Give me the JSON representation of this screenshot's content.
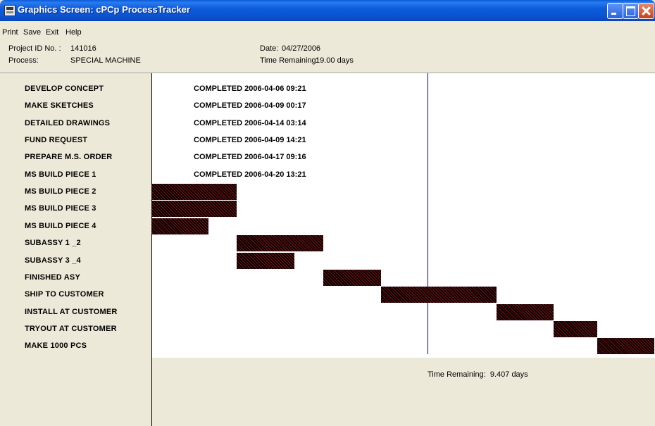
{
  "window": {
    "title": "Graphics Screen: cPCp ProcessTracker",
    "icon": "app-window-icon",
    "controls": [
      "minimize-icon",
      "maximize-icon",
      "close-icon"
    ]
  },
  "menu": [
    "Print",
    "Save",
    "Exit",
    "Help"
  ],
  "header": {
    "project_label": "Project ID No. :",
    "project_id": "141016",
    "process_label": "Process:",
    "process_value": "SPECIAL MACHINE",
    "date_label": "Date:",
    "date_value": "04/27/2006",
    "remaining_label": "Time Remaining:",
    "remaining_value": "19.00 days"
  },
  "tasks": [
    {
      "name": "DEVELOP CONCEPT",
      "status": "COMPLETED 2006-04-06  09:21"
    },
    {
      "name": "MAKE SKETCHES",
      "status": "COMPLETED 2006-04-09  00:17"
    },
    {
      "name": "DETAILED DRAWINGS",
      "status": "COMPLETED 2006-04-14  03:14"
    },
    {
      "name": "FUND REQUEST",
      "status": "COMPLETED 2006-04-09  14:21"
    },
    {
      "name": "PREPARE M.S. ORDER",
      "status": "COMPLETED 2006-04-17  09:16"
    },
    {
      "name": "MS BUILD PIECE 1",
      "status": "COMPLETED 2006-04-20  13:21"
    },
    {
      "name": "MS BUILD PIECE 2",
      "bar": {
        "start": 0.0,
        "end": 0.17
      }
    },
    {
      "name": "MS BUILD PIECE 3",
      "bar": {
        "start": 0.0,
        "end": 0.17
      }
    },
    {
      "name": "MS BUILD PIECE 4",
      "bar": {
        "start": 0.0,
        "end": 0.113
      }
    },
    {
      "name": "SUBASSY 1 _2",
      "bar": {
        "start": 0.17,
        "end": 0.342
      }
    },
    {
      "name": "SUBASSY 3 _4",
      "bar": {
        "start": 0.17,
        "end": 0.285
      }
    },
    {
      "name": "FINISHED ASY",
      "bar": {
        "start": 0.342,
        "end": 0.457
      }
    },
    {
      "name": "SHIP TO CUSTOMER",
      "bar": {
        "start": 0.457,
        "end": 0.686
      }
    },
    {
      "name": "INSTALL AT CUSTOMER",
      "bar": {
        "start": 0.686,
        "end": 0.8
      }
    },
    {
      "name": "TRYOUT AT CUSTOMER",
      "bar": {
        "start": 0.8,
        "end": 0.886
      }
    },
    {
      "name": "MAKE 1000 PCS",
      "bar": {
        "start": 0.886,
        "end": 1.0
      }
    }
  ],
  "timeline": {
    "today_marker": 0.548,
    "remaining_label": "Time Remaining:",
    "remaining_value": "9.407 days"
  },
  "colors": {
    "titlebar": "#0a52cf",
    "bar_fill": "#8a1010",
    "today_line": "#0000a0",
    "background": "#ece9d8"
  }
}
